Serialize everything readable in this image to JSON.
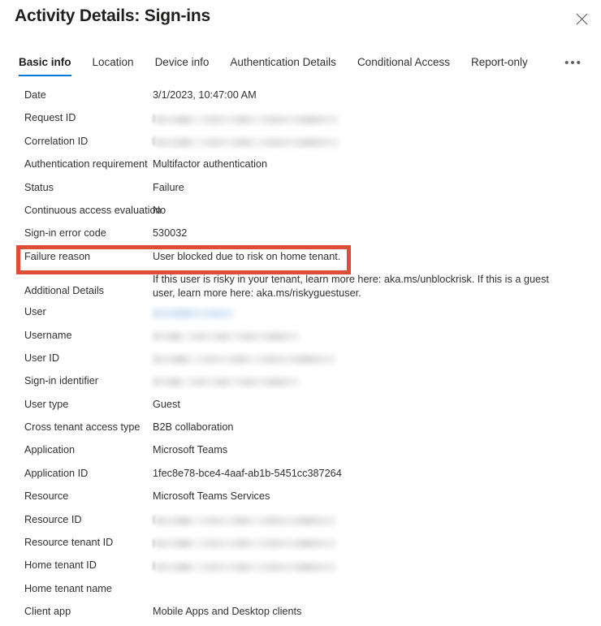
{
  "header": {
    "title": "Activity Details: Sign-ins",
    "close_icon": "close-icon"
  },
  "tabs": {
    "overflow_label": "•••",
    "items": [
      {
        "label": "Basic info",
        "active": true
      },
      {
        "label": "Location",
        "active": false
      },
      {
        "label": "Device info",
        "active": false
      },
      {
        "label": "Authentication Details",
        "active": false
      },
      {
        "label": "Conditional Access",
        "active": false
      },
      {
        "label": "Report-only",
        "active": false
      }
    ]
  },
  "highlight": {
    "color": "#e04e39",
    "target_row": "Failure reason"
  },
  "details": {
    "rows": [
      {
        "label": "Date",
        "value": "3/1/2023, 10:47:00 AM",
        "type": "text"
      },
      {
        "label": "Request ID",
        "value": "",
        "type": "redacted",
        "redact_width": 225,
        "redact_style": "grey",
        "lead": true
      },
      {
        "label": "Correlation ID",
        "value": "",
        "type": "redacted",
        "redact_width": 225,
        "redact_style": "grey",
        "lead": true
      },
      {
        "label": "Authentication requirement",
        "value": "Multifactor authentication",
        "type": "text"
      },
      {
        "label": "Status",
        "value": "Failure",
        "type": "text"
      },
      {
        "label": "Continuous access evaluation",
        "value": "No",
        "type": "text"
      },
      {
        "label": "Sign-in error code",
        "value": "530032",
        "type": "text"
      },
      {
        "label": "Failure reason",
        "value": "User blocked due to risk on home tenant.",
        "type": "text"
      },
      {
        "label": "Additional Details",
        "value": "If this user is risky in your tenant, learn more here: aka.ms/unblockrisk. If this is a guest user, learn more here: aka.ms/riskyguestuser.",
        "type": "text",
        "tall": true
      },
      {
        "label": "User",
        "value": "",
        "type": "redacted",
        "redact_width": 100,
        "redact_style": "blue",
        "lead": false
      },
      {
        "label": "Username",
        "value": "",
        "type": "redacted",
        "redact_width": 180,
        "redact_style": "grey",
        "lead": false
      },
      {
        "label": "User ID",
        "value": "",
        "type": "redacted",
        "redact_width": 225,
        "redact_style": "grey",
        "lead": false
      },
      {
        "label": "Sign-in identifier",
        "value": "",
        "type": "redacted",
        "redact_width": 180,
        "redact_style": "grey",
        "lead": false
      },
      {
        "label": "User type",
        "value": "Guest",
        "type": "text"
      },
      {
        "label": "Cross tenant access type",
        "value": "B2B collaboration",
        "type": "text"
      },
      {
        "label": "Application",
        "value": "Microsoft Teams",
        "type": "text"
      },
      {
        "label": "Application ID",
        "value": "1fec8e78-bce4-4aaf-ab1b-5451cc387264",
        "type": "text"
      },
      {
        "label": "Resource",
        "value": "Microsoft Teams Services",
        "type": "text"
      },
      {
        "label": "Resource ID",
        "value": "",
        "type": "redacted",
        "redact_width": 222,
        "redact_style": "grey",
        "lead": true
      },
      {
        "label": "Resource tenant ID",
        "value": "",
        "type": "redacted",
        "redact_width": 222,
        "redact_style": "grey",
        "lead": true
      },
      {
        "label": "Home tenant ID",
        "value": "",
        "type": "redacted",
        "redact_width": 222,
        "redact_style": "grey",
        "lead": true
      },
      {
        "label": "Home tenant name",
        "value": "",
        "type": "text"
      },
      {
        "label": "Client app",
        "value": "Mobile Apps and Desktop clients",
        "type": "text"
      }
    ]
  }
}
